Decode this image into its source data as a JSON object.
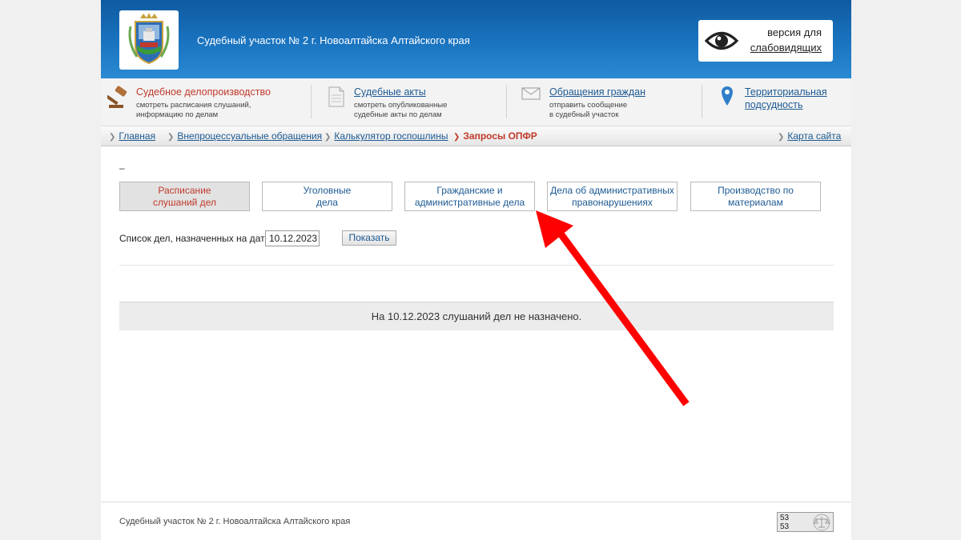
{
  "header": {
    "title": "Судебный участок № 2 г. Новоалтайска Алтайского края",
    "visually_impaired": {
      "line1": "версия для",
      "line2": "слабовидящих"
    }
  },
  "topnav": [
    {
      "title": "Судебное делопроизводство",
      "desc1": "смотреть расписания слушаний,",
      "desc2": "информацию по делам",
      "icon": "gavel-icon"
    },
    {
      "title": "Судебные акты",
      "desc1": "смотреть опубликованные",
      "desc2": "судебные акты по делам",
      "icon": "document-icon"
    },
    {
      "title": "Обращения граждан",
      "desc1": "отправить сообщение",
      "desc2": "в судебный участок",
      "icon": "envelope-icon"
    },
    {
      "title1": "Территориальная",
      "title2": "подсудность",
      "icon": "map-pin-icon"
    }
  ],
  "breadcrumbs": {
    "items": [
      "Главная",
      "Внепроцессуальные обращения",
      "Калькулятор госпошлины",
      "Запросы ОПФР"
    ],
    "sitemap": "Карта сайта"
  },
  "main": {
    "dash": "–",
    "tabs": [
      {
        "label": "Расписание\nслушаний дел",
        "active": true
      },
      {
        "label": "Уголовные\nдела",
        "active": false
      },
      {
        "label": "Гражданские и\nадминистративные дела",
        "active": false
      },
      {
        "label": "Дела об административных\nправонарушениях",
        "active": false
      },
      {
        "label": "Производство по\nматериалам",
        "active": false
      }
    ],
    "date_label": "Список дел, назначенных на дату",
    "date_value": "10.12.2023",
    "show_button": "Показать",
    "notice": "На 10.12.2023 слушаний дел не назначено."
  },
  "footer": {
    "text": "Судебный участок № 2 г. Новоалтайска Алтайского края",
    "counter": [
      "53",
      "53"
    ]
  },
  "colors": {
    "header_blue": "#1a74c0",
    "accent_red": "#c0392b",
    "link_blue": "#1d5a93",
    "annotation_arrow": "#ff0000"
  }
}
